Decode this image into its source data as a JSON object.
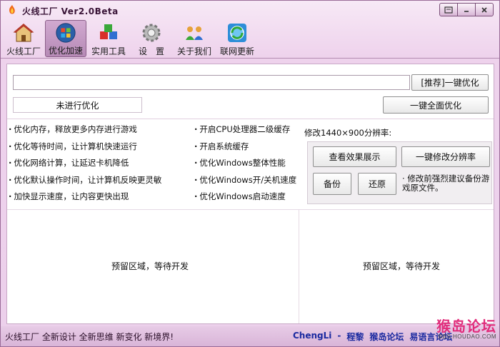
{
  "window": {
    "title": "火线工厂 Ver2.0Beta",
    "controls": [
      "restore-icon",
      "minimize-icon",
      "close-icon"
    ]
  },
  "toolbar": {
    "items": [
      {
        "label": "火线工厂",
        "icon": "house-icon"
      },
      {
        "label": "优化加速",
        "icon": "windows-orb-icon",
        "active": true
      },
      {
        "label": "实用工具",
        "icon": "cubes-icon"
      },
      {
        "label": "设　置",
        "icon": "gear-icon"
      },
      {
        "label": "关于我们",
        "icon": "people-icon"
      },
      {
        "label": "联网更新",
        "icon": "globe-refresh-icon"
      }
    ]
  },
  "optimize": {
    "path_value": "",
    "recommend_button": "[推荐]一键优化",
    "status_text": "未进行优化",
    "full_button": "一键全面优化"
  },
  "options_left": [
    "优化内存，释放更多内存进行游戏",
    "优化等待时间，让计算机快速运行",
    "优化网络计算，让延迟卡机降低",
    "优化默认操作时间，让计算机反映更灵敏",
    "加快显示速度，让内容更快出现"
  ],
  "options_right": [
    "开启CPU处理器二级缓存",
    "开启系统缓存",
    "优化Windows整体性能",
    "优化Windows开/关机速度",
    "优化Windows启动速度"
  ],
  "resolution": {
    "label": "修改1440×900分辨率:",
    "view_button": "查看效果展示",
    "modify_button": "一键修改分辨率",
    "backup_button": "备份",
    "restore_button": "还原",
    "note": "修改前强烈建议备份游戏原文件。"
  },
  "reserved": {
    "left": "预留区域，等待开发",
    "right": "预留区域，等待开发"
  },
  "statusbar": {
    "slogan": "火线工厂 全新设计 全新思维 新变化 新境界!",
    "links": [
      "ChengLi",
      "-",
      "程黎",
      "猴岛论坛",
      "易语言论坛"
    ]
  },
  "watermark": {
    "main": "猴岛论坛",
    "sub": "BBS.HOUDAO.COM"
  },
  "colors": {
    "window_bg": "#eed2ec",
    "link": "#1a2aa0",
    "watermark": "#e12c7b"
  }
}
